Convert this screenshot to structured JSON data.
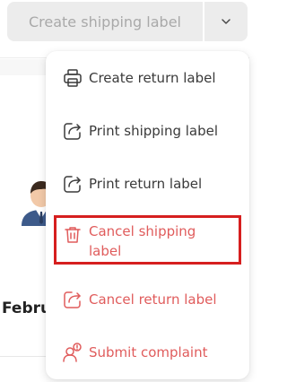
{
  "header": {
    "main_button_label": "Create shipping label",
    "toggle_icon": "chevron-down-icon"
  },
  "background": {
    "partial_date": "Febru",
    "avatar_icon": "user-avatar-icon"
  },
  "menu": {
    "items": [
      {
        "label": "Create return label",
        "icon": "printer-icon",
        "tone": "dark"
      },
      {
        "label": "Print shipping label",
        "icon": "share-arrow-icon",
        "tone": "dark"
      },
      {
        "label": "Print return label",
        "icon": "share-arrow-icon",
        "tone": "dark"
      },
      {
        "label_line1": "Cancel shipping",
        "label_line2": "label",
        "icon": "trash-icon",
        "tone": "danger",
        "highlighted": true
      },
      {
        "label": "Cancel return label",
        "icon": "share-arrow-icon",
        "tone": "danger"
      },
      {
        "label": "Submit complaint",
        "icon": "user-alert-icon",
        "tone": "danger"
      }
    ]
  },
  "colors": {
    "button_bg": "#ececec",
    "button_text": "#a9a9a9",
    "menu_text": "#3a3a3a",
    "danger_text": "#e05c5c",
    "highlight_border": "#d61f1f"
  }
}
